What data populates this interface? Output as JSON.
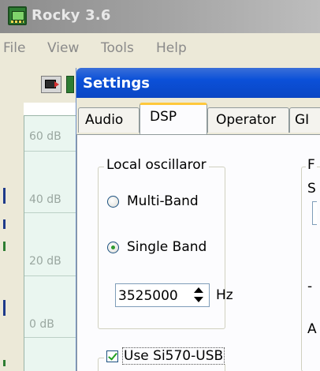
{
  "main_window": {
    "title": "Rocky 3.6",
    "menu": [
      "File",
      "View",
      "Tools",
      "Help"
    ]
  },
  "spectrum": {
    "scale_labels": [
      "60 dB",
      "40 dB",
      "20 dB",
      "0 dB"
    ]
  },
  "dialog": {
    "title": "Settings",
    "tabs": [
      {
        "label": "Audio",
        "active": false
      },
      {
        "label": "DSP",
        "active": true
      },
      {
        "label": "Operator",
        "active": false
      },
      {
        "label": "GI",
        "active": false
      }
    ],
    "local_oscillator": {
      "group_title": "Local oscillaror",
      "options": [
        {
          "label": "Multi-Band",
          "checked": false
        },
        {
          "label": "Single Band",
          "checked": true
        }
      ],
      "frequency_value": "3525000",
      "frequency_unit": "Hz"
    },
    "si570": {
      "label": "Use Si570-USB",
      "checked": true
    },
    "right_column_fragments": [
      "F",
      "S",
      "-",
      "A"
    ]
  },
  "colors": {
    "dialog_title_bar": "#0a46c4",
    "active_tab_highlight": "#ffc83c",
    "radio_dot": "#2f9a2f",
    "checkmark": "#21a121"
  }
}
